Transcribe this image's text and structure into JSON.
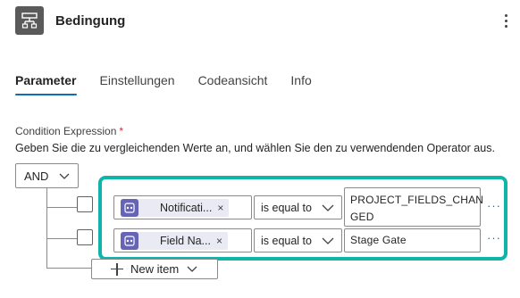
{
  "header": {
    "icon": "condition-icon",
    "title": "Bedingung",
    "more_icon": "more-vertical-icon"
  },
  "tabs": [
    {
      "label": "Parameter",
      "active": true
    },
    {
      "label": "Einstellungen",
      "active": false
    },
    {
      "label": "Codeansicht",
      "active": false
    },
    {
      "label": "Info",
      "active": false
    }
  ],
  "condition": {
    "label": "Condition Expression",
    "required_mark": "*",
    "help": "Geben Sie die zu vergleichenden Werte an, und wählen Sie den zu verwendenden Operator aus.",
    "group_operator": "AND",
    "rows": [
      {
        "token_label": "Notificati...",
        "token_icon": "dynamic-content-icon",
        "remove_glyph": "×",
        "operator": "is equal to",
        "value_line1": "PROJECT_FIELDS_CHAN",
        "value_line2": "GED",
        "more": "···"
      },
      {
        "token_label": "Field Na...",
        "token_icon": "dynamic-content-icon",
        "remove_glyph": "×",
        "operator": "is equal to",
        "value_line1": "Stage Gate",
        "more": "···"
      }
    ],
    "new_item_label": "New item"
  },
  "colors": {
    "accent": "#0f6cbd",
    "highlight": "#0fb5a8",
    "token_icon_bg": "#6664b4",
    "header_icon_bg": "#5a5a5a"
  }
}
